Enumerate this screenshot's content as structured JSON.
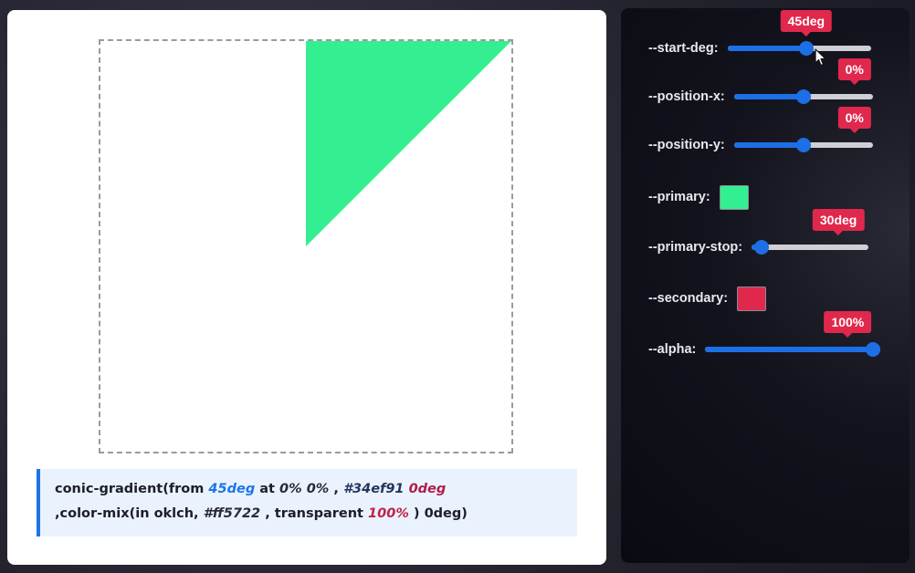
{
  "preview": {
    "primary_color": "#34ef91",
    "start_deg": 45,
    "primary_stop_deg": 30,
    "background": "#ffffff"
  },
  "code": {
    "line1": {
      "t1": "conic-gradient(from ",
      "deg": "45deg",
      "t2": " at ",
      "px": "0%",
      "t3": " ",
      "py": "0%",
      "t4": " , ",
      "color": "#34ef91",
      "t5": " ",
      "stop": "0deg"
    },
    "line2": {
      "t1": ",color-mix(in oklch, ",
      "color": "#ff5722",
      "t2": " , transparent ",
      "alpha": "100%",
      "t3": " ) 0deg)"
    }
  },
  "controls": {
    "start_deg": {
      "label": "--start-deg:",
      "value": "45deg",
      "fraction": 0.55
    },
    "position_x": {
      "label": "--position-x:",
      "value": "0%",
      "fraction": 0.5
    },
    "position_y": {
      "label": "--position-y:",
      "value": "0%",
      "fraction": 0.5
    },
    "primary": {
      "label": "--primary:",
      "color": "#34ef91"
    },
    "primary_stop": {
      "label": "--primary-stop:",
      "value": "30deg",
      "fraction": 0.083
    },
    "secondary": {
      "label": "--secondary:",
      "color": "#e0284d"
    },
    "alpha": {
      "label": "--alpha:",
      "value": "100%",
      "fraction": 1.0
    }
  },
  "colors": {
    "accent": "#1d6fe6",
    "badge": "#e0284d"
  },
  "icons": [
    "pointer-cursor-icon"
  ]
}
